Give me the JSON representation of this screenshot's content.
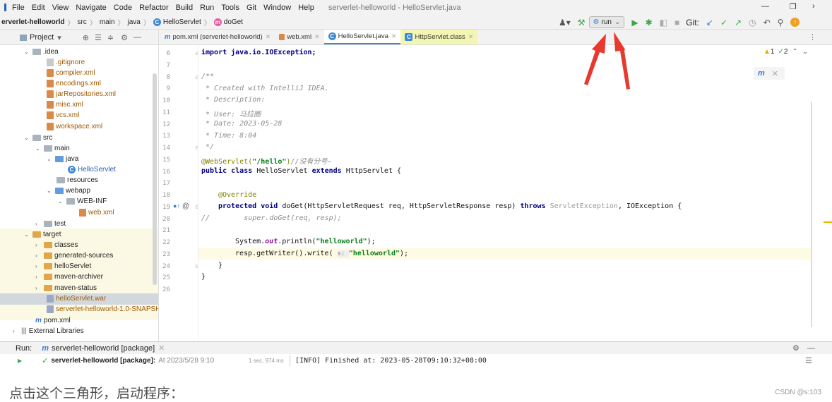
{
  "menu": {
    "items": [
      "File",
      "Edit",
      "View",
      "Navigate",
      "Code",
      "Refactor",
      "Build",
      "Run",
      "Tools",
      "Git",
      "Window",
      "Help"
    ],
    "title": "serverlet-helloworld - HelloServlet.java"
  },
  "navbar": {
    "project": "erverlet-helloworld",
    "crumbs": [
      "src",
      "main",
      "java"
    ],
    "class_crumb": "HelloServlet",
    "method_crumb": "doGet",
    "run_config": "run",
    "git_label": "Git:"
  },
  "project_panel": {
    "header": "Project"
  },
  "tabs": [
    "pom.xml (serverlet-helloworld)",
    "web.xml",
    "HelloServlet.java",
    "HttpServlet.class"
  ],
  "tree": [
    ".idea",
    ".gitignore",
    "compiler.xml",
    "encodings.xml",
    "jarRepositories.xml",
    "misc.xml",
    "vcs.xml",
    "workspace.xml",
    "src",
    "main",
    "java",
    "HelloServlet",
    "resources",
    "webapp",
    "WEB-INF",
    "web.xml",
    "test",
    "target",
    "classes",
    "generated-sources",
    "helloServlet",
    "maven-archiver",
    "maven-status",
    "helloServlet.war",
    "serverlet-helloworld-1.0-SNAPSH",
    "pom.xml",
    "External Libraries"
  ],
  "line_numbers": [
    "6",
    "7",
    "8",
    "9",
    "10",
    "11",
    "12",
    "13",
    "14",
    "15",
    "16",
    "17",
    "18",
    "19",
    "20",
    "21",
    "22",
    "23",
    "24",
    "25",
    "26"
  ],
  "code": {
    "import": "import java.io.IOException;",
    "c1": "/**",
    "c2": " * Created with IntelliJ IDEA.",
    "c3": " * Description:",
    "c4": " * User: 马拉圈",
    "c5": " * Date: 2023-05-28",
    "c6": " * Time: 8:04",
    "c7": " */",
    "ann1": "@WebServlet(",
    "ann1s": "\"/hello\"",
    "ann1e": ")",
    "ann1c": "//没有分号~",
    "cls_kw": "public class ",
    "cls_name": "HelloServlet ",
    "cls_ext": "extends ",
    "cls_rest": "HttpServlet {",
    "ann2": "@Override",
    "m_kw": "protected void ",
    "m_sig": "doGet(HttpServletRequest req, HttpServletResponse resp) ",
    "m_throws": "throws ",
    "m_exc": "ServletException",
    "m_rest": ", IOException {",
    "commented": "//        super.doGet(req, resp);",
    "p1": "System.",
    "p1o": "out",
    "p1r": ".println(",
    "p1s": "\"helloworld\"",
    "p1e": ");",
    "p2": "resp.getWriter().write( ",
    "p2h": "s: ",
    "p2s": "\"helloworld\"",
    "p2e": ");",
    "b1": "}",
    "b2": "}"
  },
  "inspections": {
    "warn": "1",
    "ok": "2"
  },
  "run_panel": {
    "label": "Run:",
    "tab": "serverlet-helloworld [package]",
    "task": "serverlet-helloworld [package]:",
    "time": "At 2023/5/28 9:10",
    "duration": "1 sec, 974 ms",
    "output": "[INFO] Finished at: 2023-05-28T09:10:32+08:00"
  },
  "sidebar_bottom": {
    "ext": "External Libraries"
  },
  "caption": "点击这个三角形，启动程序：",
  "watermark": "CSDN @s:103",
  "colors": {
    "accent": "#4a86c7",
    "arrow": "#e8392e",
    "run_green": "#3aa74a"
  }
}
